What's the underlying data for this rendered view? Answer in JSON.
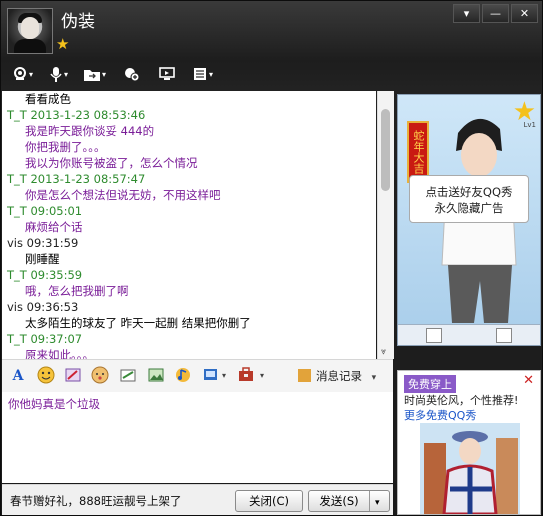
{
  "window": {
    "title": "伪装",
    "controls": [
      "▾",
      "—",
      "✕"
    ]
  },
  "chat": [
    {
      "type": "msg-k",
      "text": "看看成色"
    },
    {
      "type": "hdr-t",
      "text": "T_T  2013-1-23 08:53:46"
    },
    {
      "type": "msg-p",
      "text": "我是昨天跟你谈妥 444的"
    },
    {
      "type": "msg-p",
      "text": "你把我删了。。。"
    },
    {
      "type": "msg-p",
      "text": "我以为你账号被盗了，怎么个情况"
    },
    {
      "type": "hdr-t",
      "text": "T_T  2013-1-23 08:57:47"
    },
    {
      "type": "msg-p",
      "text": "你是怎么个想法但说无妨，不用这样吧"
    },
    {
      "type": "hdr-t",
      "text": "T_T   09:05:01"
    },
    {
      "type": "msg-p",
      "text": "麻烦给个话"
    },
    {
      "type": "hdr-v",
      "text": "vis   09:31:59"
    },
    {
      "type": "msg-k",
      "text": "刚睡醒"
    },
    {
      "type": "hdr-t",
      "text": "T_T   09:35:59"
    },
    {
      "type": "msg-p",
      "text": "哦，怎么把我删了啊"
    },
    {
      "type": "hdr-v",
      "text": "vis   09:36:53"
    },
    {
      "type": "msg-k",
      "text": "太多陌生的球友了  昨天一起删  结果把你删了"
    },
    {
      "type": "hdr-t",
      "text": "T_T   09:37:07"
    },
    {
      "type": "msg-p",
      "text": "原来如此。。。"
    }
  ],
  "format_bar": {
    "icons": [
      "font-icon",
      "smiley-icon",
      "magic-icon",
      "emoji-icon",
      "screenshot-icon",
      "image-icon",
      "music-icon",
      "send-image-icon",
      "toolbox-icon"
    ],
    "history_label": "消息记录"
  },
  "input": {
    "text": "你他妈真是个垃圾"
  },
  "bottom": {
    "promo": "春节赠好礼，888旺运靓号上架了",
    "close_label": "关闭(C)",
    "send_label": "发送(S)"
  },
  "side_panel": {
    "banner_text": "蛇年大吉",
    "level_label": "Lv1",
    "bubble_line1": "点击送好友QQ秀",
    "bubble_line2": "永久隐藏广告"
  },
  "ad": {
    "tag": "免费穿上",
    "line1": "时尚英伦风，个性推荐!",
    "line2": "更多免费QQ秀"
  },
  "colors": {
    "titlebar": "#2a2a2a",
    "chat_bg": "#ffffff",
    "purple_text": "#7a1d98",
    "green_header": "#2e8b2e",
    "accent_ad": "#8a5ac8"
  }
}
